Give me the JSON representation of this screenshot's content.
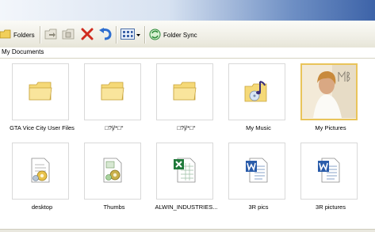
{
  "toolbar": {
    "folders_label": "Folders",
    "folder_sync_label": "Folder Sync"
  },
  "address": {
    "path": "My Documents"
  },
  "colors": {
    "folder": "#f5d978",
    "undo": "#2f6fd0",
    "delete": "#d02b1e",
    "word": "#2a5caa",
    "excel": "#1f7a3a"
  },
  "items": [
    {
      "label": "GTA Vice City User Files",
      "icon": "folder-icon"
    },
    {
      "label": "□?|/*□°",
      "icon": "folder-icon"
    },
    {
      "label": "□?|/*□°",
      "icon": "folder-icon"
    },
    {
      "label": "My Music",
      "icon": "music-folder-icon"
    },
    {
      "label": "My Pictures",
      "icon": "pictures-folder-icon"
    },
    {
      "label": "desktop",
      "icon": "config-file-icon"
    },
    {
      "label": "Thumbs",
      "icon": "thumbs-db-icon"
    },
    {
      "label": "ALWIN_INDUSTRIES...",
      "icon": "excel-file-icon"
    },
    {
      "label": "3R pics",
      "icon": "word-file-icon"
    },
    {
      "label": "3R pictures",
      "icon": "word-file-icon"
    }
  ]
}
